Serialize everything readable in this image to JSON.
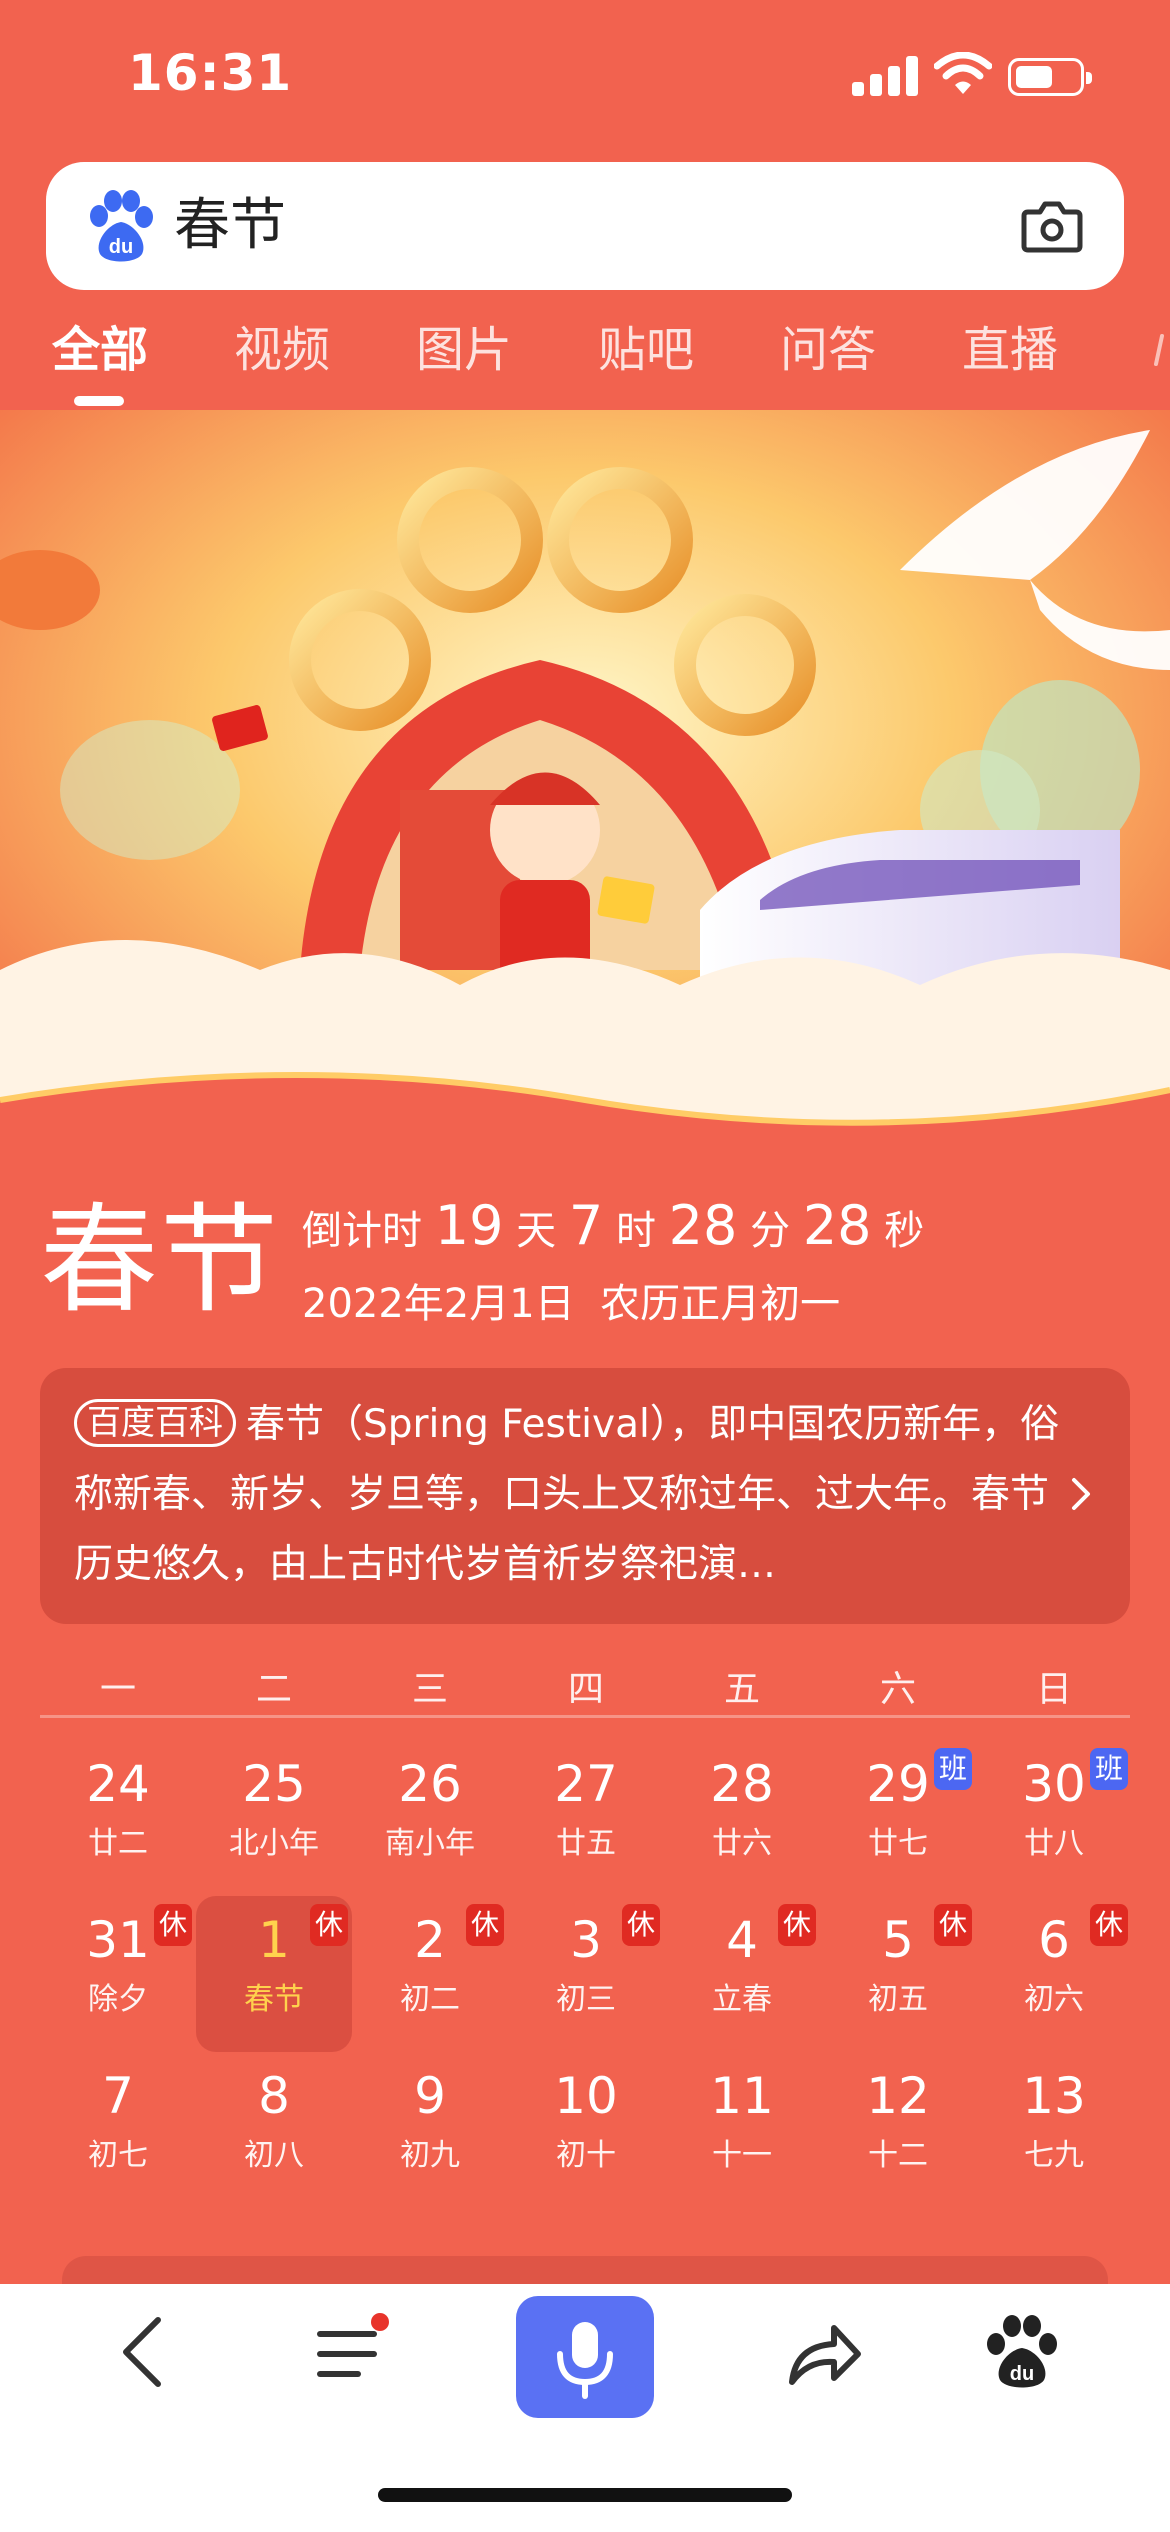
{
  "status_bar": {
    "time": "16:31"
  },
  "search": {
    "query": "春节"
  },
  "tabs": [
    {
      "label": "全部",
      "active": true
    },
    {
      "label": "视频"
    },
    {
      "label": "图片"
    },
    {
      "label": "贴吧"
    },
    {
      "label": "问答"
    },
    {
      "label": "直播"
    }
  ],
  "festival": {
    "title": "春节",
    "countdown_label": "倒计时",
    "days": "19",
    "days_unit": "天",
    "hours": "7",
    "hours_unit": "时",
    "minutes": "28",
    "minutes_unit": "分",
    "seconds": "28",
    "seconds_unit": "秒",
    "date": "2022年2月1日",
    "lunar_date": "农历正月初一"
  },
  "encyclopedia": {
    "badge": "百度百科",
    "text": "春节（Spring Festival），即中国农历新年，俗称新春、新岁、岁旦等，口头上又称过年、过大年。春节历史悠久，由上古时代岁首祈岁祭祀演…"
  },
  "calendar": {
    "weekdays": [
      "一",
      "二",
      "三",
      "四",
      "五",
      "六",
      "日"
    ],
    "weeks": [
      [
        {
          "day": "24",
          "lunar": "廿二"
        },
        {
          "day": "25",
          "lunar": "北小年"
        },
        {
          "day": "26",
          "lunar": "南小年"
        },
        {
          "day": "27",
          "lunar": "廿五"
        },
        {
          "day": "28",
          "lunar": "廿六"
        },
        {
          "day": "29",
          "lunar": "廿七",
          "tag": "班"
        },
        {
          "day": "30",
          "lunar": "廿八",
          "tag": "班"
        }
      ],
      [
        {
          "day": "31",
          "lunar": "除夕",
          "tag": "休"
        },
        {
          "day": "1",
          "lunar": "春节",
          "tag": "休",
          "today": true
        },
        {
          "day": "2",
          "lunar": "初二",
          "tag": "休"
        },
        {
          "day": "3",
          "lunar": "初三",
          "tag": "休"
        },
        {
          "day": "4",
          "lunar": "立春",
          "tag": "休"
        },
        {
          "day": "5",
          "lunar": "初五",
          "tag": "休"
        },
        {
          "day": "6",
          "lunar": "初六",
          "tag": "休"
        }
      ],
      [
        {
          "day": "7",
          "lunar": "初七"
        },
        {
          "day": "8",
          "lunar": "初八"
        },
        {
          "day": "9",
          "lunar": "初九"
        },
        {
          "day": "10",
          "lunar": "初十"
        },
        {
          "day": "11",
          "lunar": "十一"
        },
        {
          "day": "12",
          "lunar": "十二"
        },
        {
          "day": "13",
          "lunar": "七九"
        }
      ]
    ]
  },
  "toolbar": {
    "icons": [
      "back-icon",
      "menu-icon",
      "microphone-icon",
      "share-icon",
      "baidu-paw-icon"
    ]
  },
  "colors": {
    "background": "#f2624f",
    "rest_tag": "#e02a22",
    "work_tag": "#4c67f2",
    "voice_button": "#5a71f3",
    "today_text": "#ffd24d"
  }
}
